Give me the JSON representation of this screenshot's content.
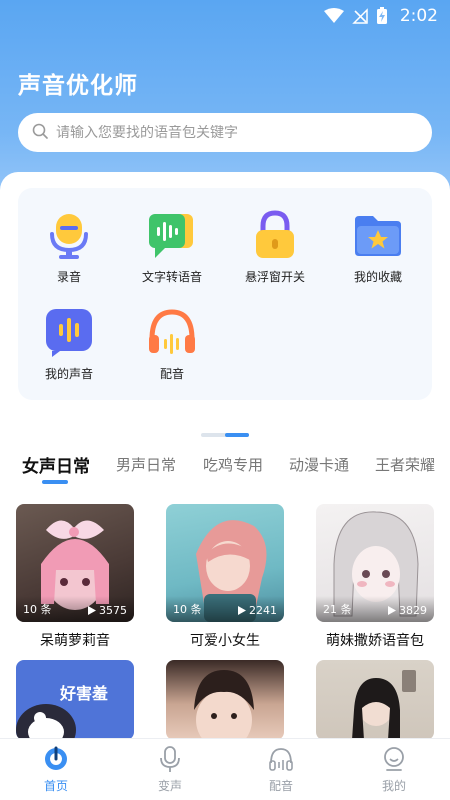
{
  "status_bar": {
    "time": "2:02"
  },
  "header": {
    "title": "声音优化师"
  },
  "search": {
    "placeholder": "请输入您要找的语音包关键字"
  },
  "functions": [
    {
      "label": "录音",
      "icon": "microphone-icon"
    },
    {
      "label": "文字转语音",
      "icon": "text-to-speech-icon"
    },
    {
      "label": "悬浮窗开关",
      "icon": "lock-icon"
    },
    {
      "label": "我的收藏",
      "icon": "star-folder-icon"
    },
    {
      "label": "我的声音",
      "icon": "voice-wave-icon"
    },
    {
      "label": "配音",
      "icon": "headphones-icon"
    }
  ],
  "tabs": [
    {
      "label": "女声日常",
      "active": true
    },
    {
      "label": "男声日常",
      "active": false
    },
    {
      "label": "吃鸡专用",
      "active": false
    },
    {
      "label": "动漫卡通",
      "active": false
    },
    {
      "label": "王者荣耀",
      "active": false
    }
  ],
  "cards": [
    {
      "title": "呆萌萝莉音",
      "count": "10 条",
      "plays": "3575"
    },
    {
      "title": "可爱小女生",
      "count": "10 条",
      "plays": "2241"
    },
    {
      "title": "萌妹撒娇语音包",
      "count": "21 条",
      "plays": "3829"
    }
  ],
  "cards_row2": [
    {
      "overlay_text": "好害羞"
    }
  ],
  "bottom_nav": [
    {
      "label": "首页",
      "active": true
    },
    {
      "label": "变声",
      "active": false
    },
    {
      "label": "配音",
      "active": false
    },
    {
      "label": "我的",
      "active": false
    }
  ],
  "colors": {
    "accent": "#3a8ff2",
    "header_top": "#5aa6f2"
  }
}
